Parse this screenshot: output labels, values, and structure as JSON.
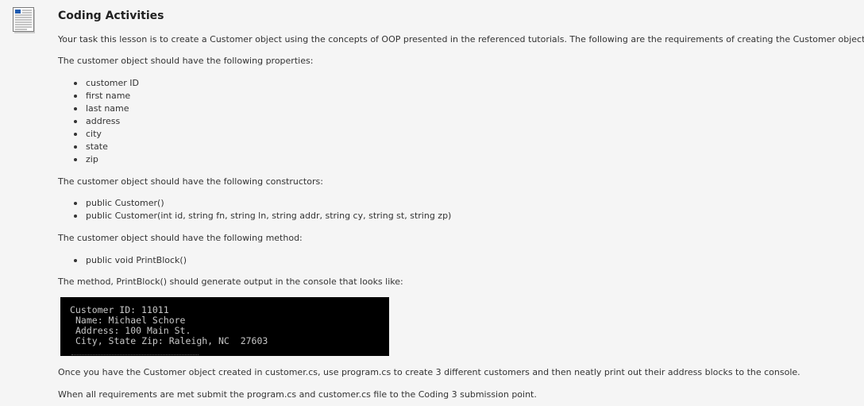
{
  "activity": {
    "title": "Coding Activities",
    "intro": "Your task this lesson is to create a Customer object using the concepts of OOP presented in the referenced tutorials. The following are the requirements of creating the Customer object.",
    "properties_heading": "The customer object should have the following properties:",
    "properties": [
      "customer ID",
      "first name",
      "last name",
      "address",
      "city",
      "state",
      "zip"
    ],
    "constructors_heading": "The customer object should have the following constructors:",
    "constructors": [
      "public Customer()",
      "public Customer(int id, string fn, string ln, string addr, string cy, string st, string zp)"
    ],
    "method_heading": "The customer object should have the following method:",
    "methods": [
      "public void PrintBlock()"
    ],
    "output_heading": "The method, PrintBlock() should generate output in the console that looks like:",
    "console_lines": [
      "Customer ID: 11011",
      "Name: Michael Schore",
      "Address: 100 Main St.",
      "City, State Zip: Raleigh, NC  27603"
    ],
    "instructions": "Once you have the Customer object created in customer.cs, use program.cs to create 3 different customers and then neatly print out their address blocks to the console.",
    "submission": "When all requirements are met submit the program.cs and customer.cs file to the Coding 3 submission point."
  },
  "icons": {
    "document": "document-icon"
  }
}
